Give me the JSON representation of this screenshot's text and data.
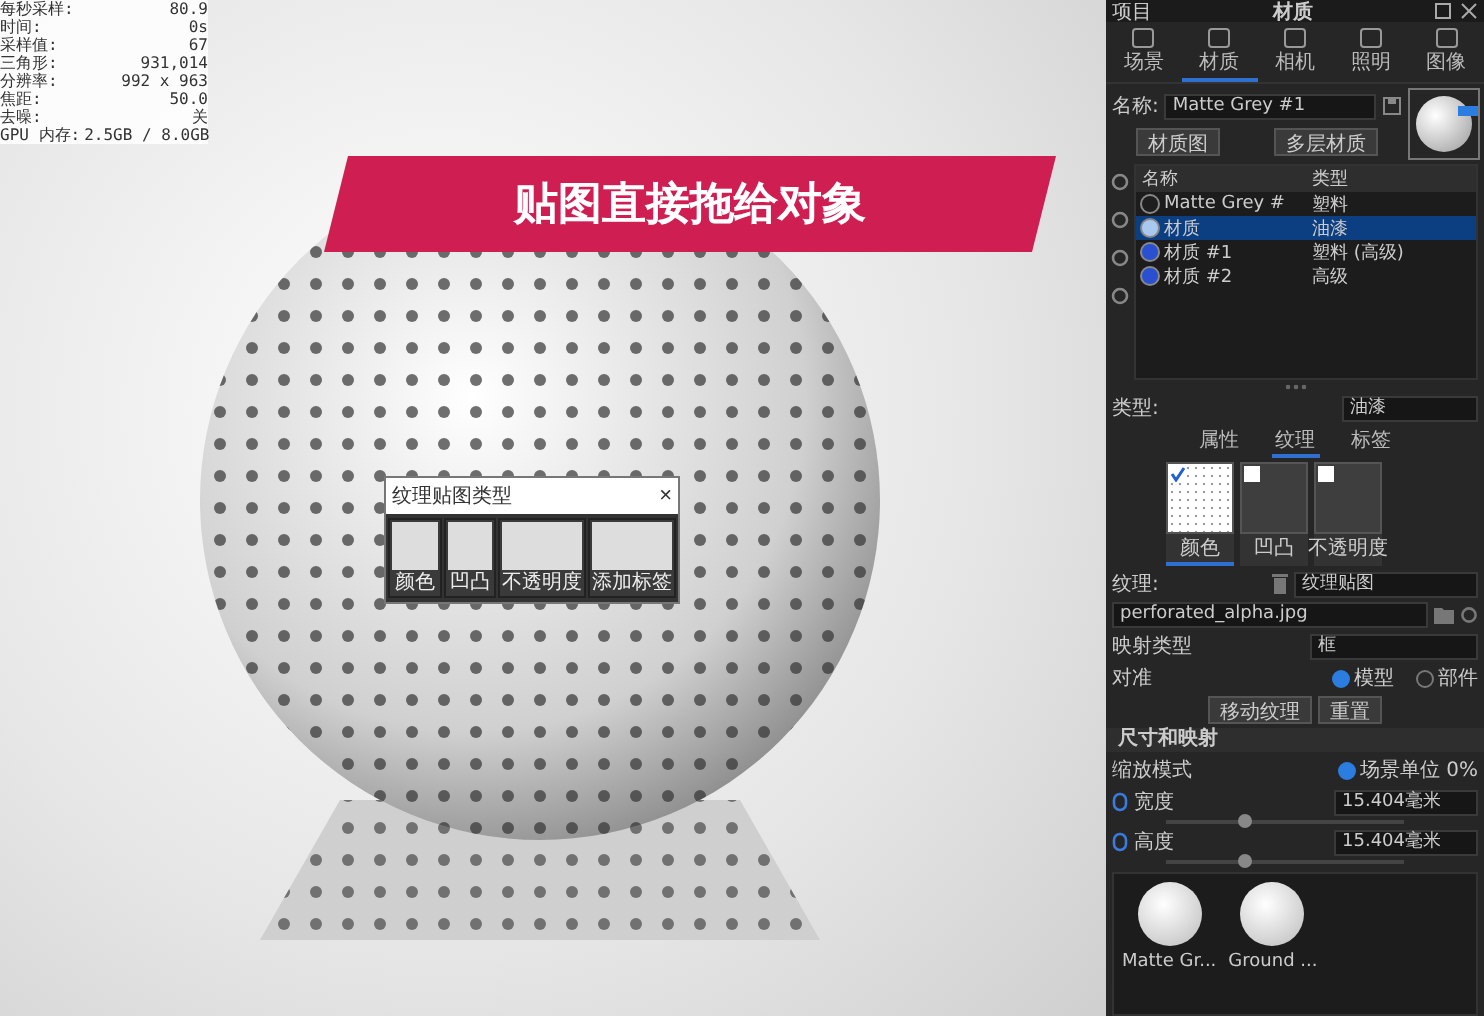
{
  "stats": [
    {
      "label": "每秒采样:",
      "value": "80.9"
    },
    {
      "label": "时间:",
      "value": "0s"
    },
    {
      "label": "采样值:",
      "value": "67"
    },
    {
      "label": "三角形:",
      "value": "931,014"
    },
    {
      "label": "分辨率:",
      "value": "992 x 963"
    },
    {
      "label": "焦距:",
      "value": "50.0"
    },
    {
      "label": "去噪:",
      "value": "关"
    },
    {
      "label": "GPU 内存:",
      "value": "2.5GB / 8.0GB"
    }
  ],
  "banner": {
    "text": "贴图直接拖给对象"
  },
  "dialog": {
    "title": "纹理贴图类型",
    "close": "×",
    "options": [
      "颜色",
      "凹凸",
      "不透明度",
      "添加标签"
    ]
  },
  "panel": {
    "header_left": "项目",
    "title": "材质",
    "tabs": [
      {
        "label": "场景",
        "selected": false
      },
      {
        "label": "材质",
        "selected": true
      },
      {
        "label": "相机",
        "selected": false
      },
      {
        "label": "照明",
        "selected": false
      },
      {
        "label": "图像",
        "selected": false
      }
    ],
    "name_label": "名称:",
    "name_value": "Matte Grey #1",
    "buttons": [
      "材质图",
      "多层材质"
    ],
    "list": {
      "columns": [
        "名称",
        "类型"
      ],
      "rows": [
        {
          "name": "Matte Grey #",
          "type": "塑料",
          "selected": false,
          "color": "#1e1e1e"
        },
        {
          "name": "材质",
          "type": "油漆",
          "selected": true,
          "color": "#a8c8f0"
        },
        {
          "name": "材质 #1",
          "type": "塑料 (高级)",
          "selected": false,
          "color": "#2850d0"
        },
        {
          "name": "材质 #2",
          "type": "高级",
          "selected": false,
          "color": "#2850d0"
        }
      ]
    },
    "type_label": "类型:",
    "type_value": "油漆",
    "subtabs": [
      {
        "label": "属性",
        "selected": false
      },
      {
        "label": "纹理",
        "selected": true
      },
      {
        "label": "标签",
        "selected": false
      }
    ],
    "slots": [
      {
        "label": "颜色",
        "checked": true,
        "selected": true
      },
      {
        "label": "凹凸",
        "checked": false,
        "selected": false
      },
      {
        "label": "不透明度",
        "checked": false,
        "selected": false
      }
    ],
    "texture_label": "纹理:",
    "texture_value": "纹理贴图",
    "file": "perforated_alpha.jpg",
    "mapping_label": "映射类型",
    "mapping_value": "框",
    "align_label": "对准",
    "align_options": [
      {
        "label": "模型",
        "selected": true
      },
      {
        "label": "部件",
        "selected": false
      }
    ],
    "actions": [
      "移动纹理",
      "重置"
    ],
    "section": "尺寸和映射",
    "scale_label": "缩放模式",
    "scale_option": {
      "label": "场景单位",
      "selected": true
    },
    "scale_value": "0%",
    "dims": [
      {
        "label": "宽度",
        "value": "15.404毫米",
        "level": 0.3
      },
      {
        "label": "高度",
        "value": "15.404毫米",
        "level": 0.3
      }
    ],
    "library": [
      "Matte Gr...",
      "Ground ..."
    ]
  }
}
